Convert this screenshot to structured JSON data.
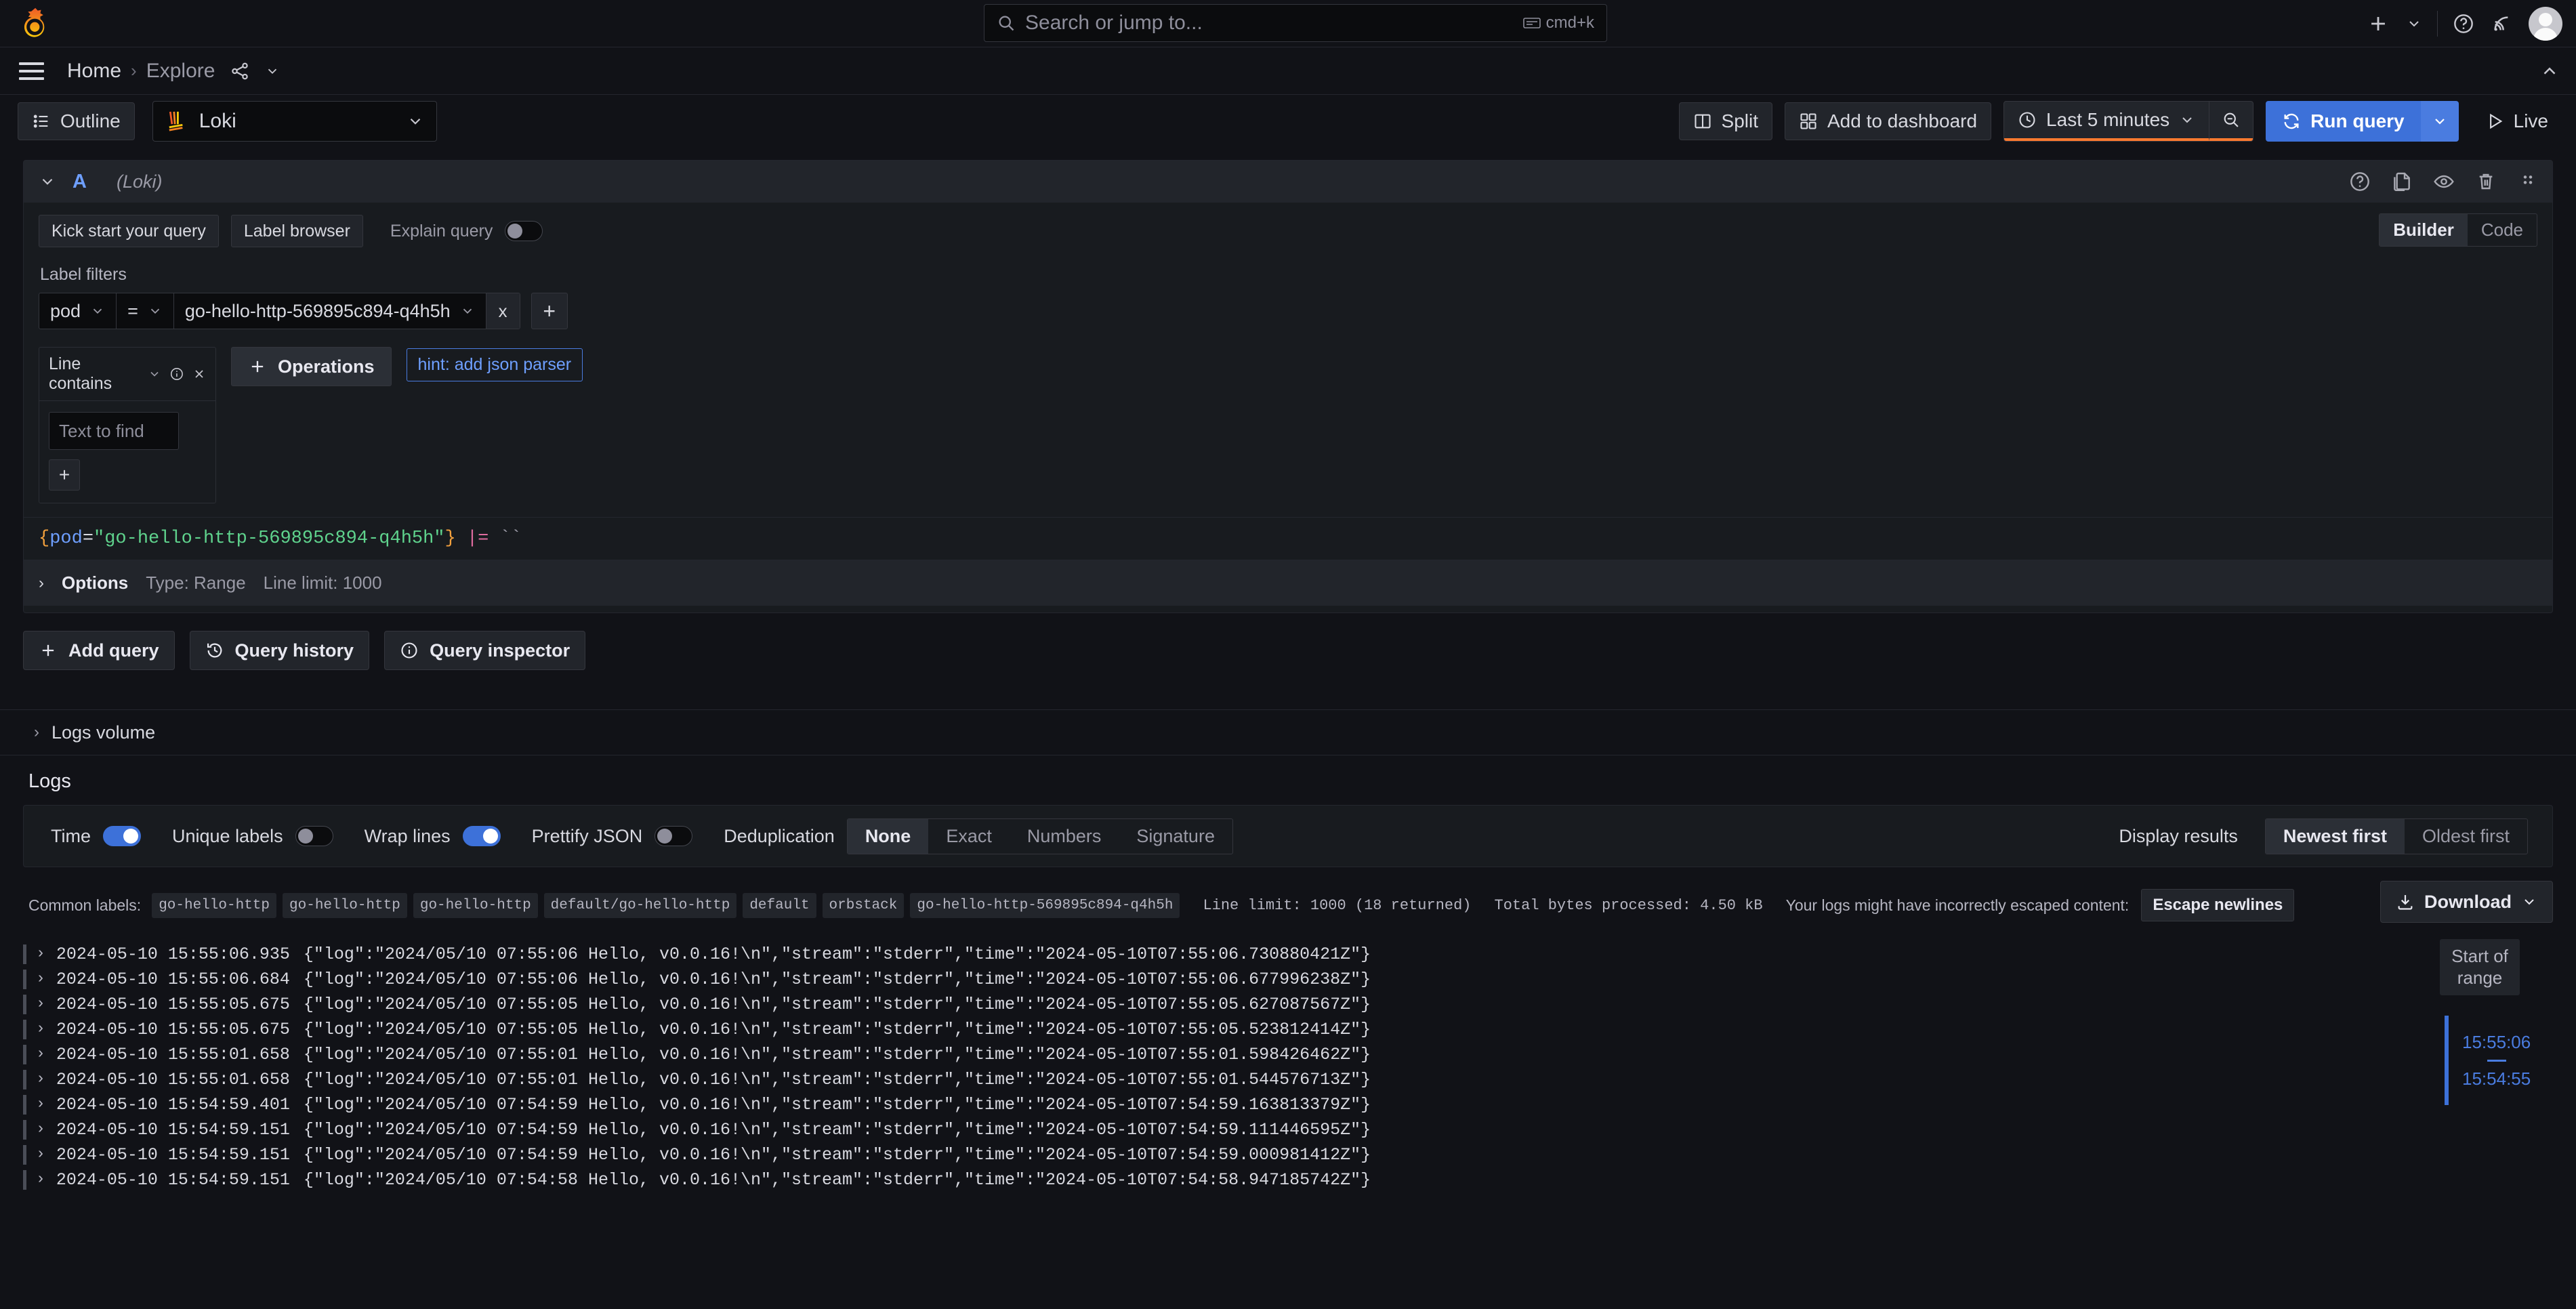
{
  "topnav": {
    "logo_name": "grafana-logo",
    "search": {
      "placeholder": "Search or jump to...",
      "shortcut": "cmd+k"
    },
    "icons": {
      "plus": "plus-icon",
      "plus_caret": "chevron-down-icon",
      "help": "help-circle-icon",
      "news": "news-rss-icon",
      "avatar": "user-avatar"
    }
  },
  "breadcrumb": {
    "menu": "hamburger-menu-icon",
    "home": "Home",
    "separator": "›",
    "current": "Explore",
    "share": "share-icon",
    "caret": "chevron-down-icon"
  },
  "toolbar": {
    "outline_label": "Outline",
    "datasource": "Loki",
    "split_label": "Split",
    "add_to_dashboard_label": "Add to dashboard",
    "time_range": "Last 5 minutes",
    "run_query_label": "Run query",
    "live_label": "Live"
  },
  "query": {
    "ref_id": "A",
    "datasource_note": "(Loki)",
    "kick_start_label": "Kick start your query",
    "label_browser_label": "Label browser",
    "explain_query_label": "Explain query",
    "explain_query_on": false,
    "mode_builder": "Builder",
    "mode_code": "Code",
    "mode_active": "Builder",
    "label_filters_title": "Label filters",
    "filter": {
      "key": "pod",
      "operator": "=",
      "value": "go-hello-http-569895c894-q4h5h",
      "remove_label": "x",
      "add_label": "+"
    },
    "operation": {
      "name": "Line contains",
      "input_placeholder": "Text to find",
      "add_label": "+"
    },
    "operations_button": "Operations",
    "hint_label": "hint: add json parser",
    "expression": {
      "open_brace": "{",
      "label": "pod",
      "equals": "=",
      "value": "\"go-hello-http-569895c894-q4h5h\"",
      "close_brace": "}",
      "line_filter_op": "|=",
      "line_filter_value": "``"
    },
    "options": {
      "title": "Options",
      "type": "Type: Range",
      "line_limit": "Line limit: 1000"
    },
    "add_query_label": "Add query",
    "query_history_label": "Query history",
    "query_inspector_label": "Query inspector"
  },
  "logs_volume": {
    "title": "Logs volume"
  },
  "logs": {
    "title": "Logs",
    "controls": {
      "time_label": "Time",
      "time_on": true,
      "unique_labels_label": "Unique labels",
      "unique_labels_on": false,
      "wrap_lines_label": "Wrap lines",
      "wrap_lines_on": true,
      "prettify_json_label": "Prettify JSON",
      "prettify_json_on": false,
      "deduplication_label": "Deduplication",
      "deduplication_options": [
        "None",
        "Exact",
        "Numbers",
        "Signature"
      ],
      "deduplication_active": "None",
      "display_results_label": "Display results",
      "display_results_options": [
        "Newest first",
        "Oldest first"
      ],
      "display_results_active": "Newest first"
    },
    "meta": {
      "common_labels_label": "Common labels:",
      "common_labels": [
        "go-hello-http",
        "go-hello-http",
        "go-hello-http",
        "default/go-hello-http",
        "default",
        "orbstack",
        "go-hello-http-569895c894-q4h5h"
      ],
      "line_limit": "Line limit: 1000 (18 returned)",
      "total_bytes": "Total bytes processed: 4.50 kB",
      "escaped_notice": "Your logs might have incorrectly escaped content:",
      "escape_newlines_label": "Escape newlines",
      "download_label": "Download"
    },
    "rows": [
      {
        "timestamp": "2024-05-10 15:55:06.935",
        "message": "{\"log\":\"2024/05/10 07:55:06 Hello, v0.0.16!\\n\",\"stream\":\"stderr\",\"time\":\"2024-05-10T07:55:06.730880421Z\"}"
      },
      {
        "timestamp": "2024-05-10 15:55:06.684",
        "message": "{\"log\":\"2024/05/10 07:55:06 Hello, v0.0.16!\\n\",\"stream\":\"stderr\",\"time\":\"2024-05-10T07:55:06.677996238Z\"}"
      },
      {
        "timestamp": "2024-05-10 15:55:05.675",
        "message": "{\"log\":\"2024/05/10 07:55:05 Hello, v0.0.16!\\n\",\"stream\":\"stderr\",\"time\":\"2024-05-10T07:55:05.627087567Z\"}"
      },
      {
        "timestamp": "2024-05-10 15:55:05.675",
        "message": "{\"log\":\"2024/05/10 07:55:05 Hello, v0.0.16!\\n\",\"stream\":\"stderr\",\"time\":\"2024-05-10T07:55:05.523812414Z\"}"
      },
      {
        "timestamp": "2024-05-10 15:55:01.658",
        "message": "{\"log\":\"2024/05/10 07:55:01 Hello, v0.0.16!\\n\",\"stream\":\"stderr\",\"time\":\"2024-05-10T07:55:01.598426462Z\"}"
      },
      {
        "timestamp": "2024-05-10 15:55:01.658",
        "message": "{\"log\":\"2024/05/10 07:55:01 Hello, v0.0.16!\\n\",\"stream\":\"stderr\",\"time\":\"2024-05-10T07:55:01.544576713Z\"}"
      },
      {
        "timestamp": "2024-05-10 15:54:59.401",
        "message": "{\"log\":\"2024/05/10 07:54:59 Hello, v0.0.16!\\n\",\"stream\":\"stderr\",\"time\":\"2024-05-10T07:54:59.163813379Z\"}"
      },
      {
        "timestamp": "2024-05-10 15:54:59.151",
        "message": "{\"log\":\"2024/05/10 07:54:59 Hello, v0.0.16!\\n\",\"stream\":\"stderr\",\"time\":\"2024-05-10T07:54:59.111446595Z\"}"
      },
      {
        "timestamp": "2024-05-10 15:54:59.151",
        "message": "{\"log\":\"2024/05/10 07:54:59 Hello, v0.0.16!\\n\",\"stream\":\"stderr\",\"time\":\"2024-05-10T07:54:59.000981412Z\"}"
      },
      {
        "timestamp": "2024-05-10 15:54:59.151",
        "message": "{\"log\":\"2024/05/10 07:54:58 Hello, v0.0.16!\\n\",\"stream\":\"stderr\",\"time\":\"2024-05-10T07:54:58.947185742Z\"}"
      }
    ],
    "range_indicator": {
      "label": "Start of range",
      "start_time": "15:55:06",
      "end_time": "15:54:55"
    }
  },
  "colors": {
    "accent_blue": "#3d71d9",
    "accent_orange": "#ff7a2f",
    "panel_bg": "#181b1f",
    "page_bg": "#111217"
  }
}
